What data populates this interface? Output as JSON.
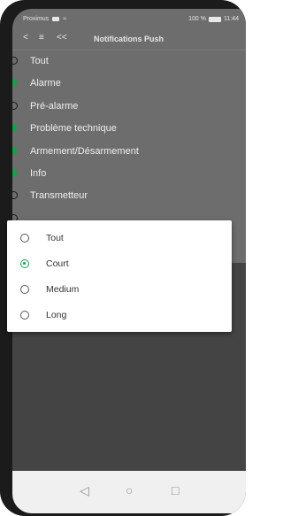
{
  "status_bar": {
    "carrier": "Proximus",
    "battery_text": "100 %",
    "time": "11:44"
  },
  "app_bar": {
    "title": "Notifications Push",
    "back_icon": "back-chevron-icon",
    "menu_icon": "menu-icon",
    "double_back_icon": "double-chevron-left-icon"
  },
  "items": [
    {
      "label": "Tout",
      "enabled": false
    },
    {
      "label": "Alarme",
      "enabled": true
    },
    {
      "label": "Pré-alarme",
      "enabled": false
    },
    {
      "label": "Problème technique",
      "enabled": true
    },
    {
      "label": "Armement/Désarmement",
      "enabled": true
    },
    {
      "label": "Info",
      "enabled": true
    },
    {
      "label": "Transmetteur",
      "enabled": false
    }
  ],
  "dialog": {
    "options": [
      {
        "label": "Tout",
        "selected": false
      },
      {
        "label": "Court",
        "selected": true
      },
      {
        "label": "Medium",
        "selected": false
      },
      {
        "label": "Long",
        "selected": false
      }
    ]
  },
  "nav": {
    "back_icon": "triangle-back-icon",
    "home_icon": "circle-home-icon",
    "recents_icon": "square-recents-icon"
  },
  "colors": {
    "accent_green": "#1f9a4a",
    "overlay_dim": "#6d6d6d"
  }
}
